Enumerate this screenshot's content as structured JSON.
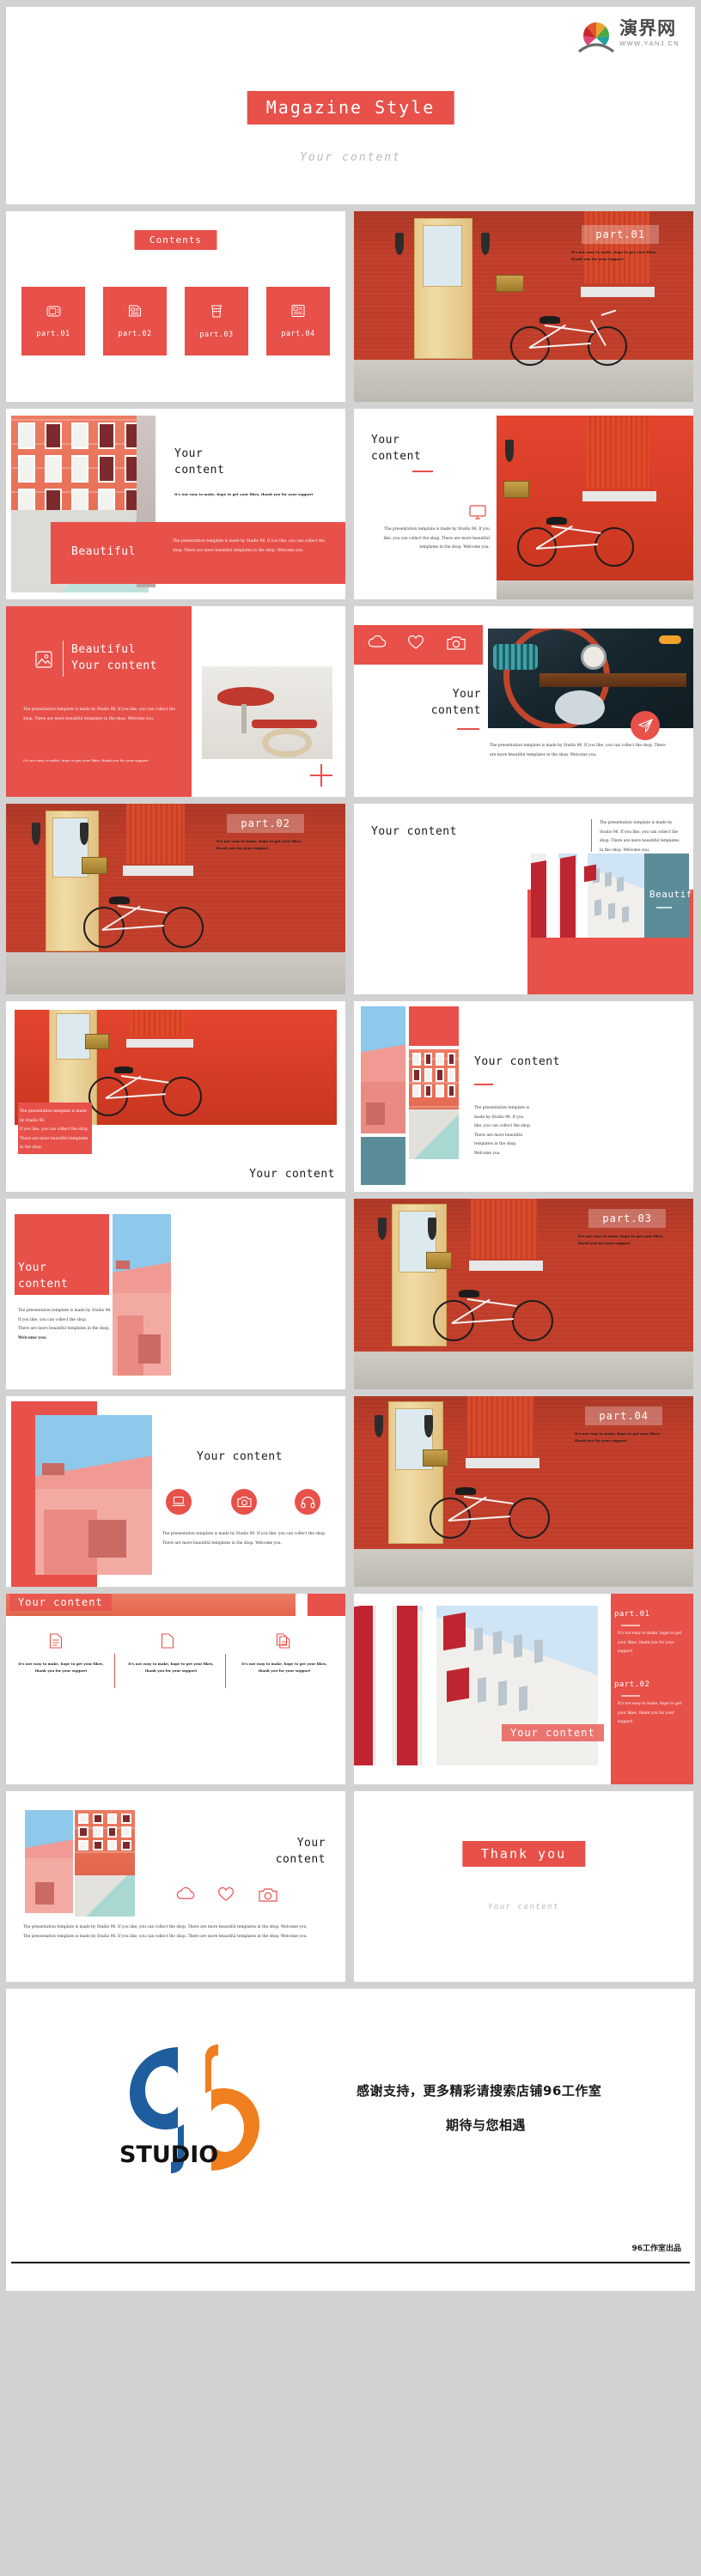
{
  "brand": {
    "name_cn": "演界网",
    "url": "WWW.YANJ.CN",
    "logo_icon": "fan-logo-icon"
  },
  "cover": {
    "title": "Magazine Style",
    "subtitle": "Your content"
  },
  "common": {
    "heading_your": "Your",
    "heading_content": "content",
    "heading_your_content": "Your content",
    "beautiful": "Beautiful",
    "body_long": "The presentation template is made by Studio 96. If you like, you can collect the shop. There are more beautiful templates in the shop. Welcome you.",
    "body_l1": "The presentation template is made by Studio 96.",
    "body_l2": "If you like, you can collect the shop.",
    "body_l3": "There are more beautiful templates in the shop.",
    "welcome": "Welcome you.",
    "support_note": "It's not easy to make, hope to get your likes, thank you for your support",
    "support_l1": "It's not easy to make, hope to get your likes,",
    "support_l2": "thank you for your support"
  },
  "contents": {
    "title": "Contents",
    "cards": [
      {
        "label": "part.01",
        "icon": "tv-icon"
      },
      {
        "label": "part.02",
        "icon": "document-icon"
      },
      {
        "label": "part.03",
        "icon": "coffee-cup-icon"
      },
      {
        "label": "part.04",
        "icon": "newspaper-icon"
      }
    ]
  },
  "parts": {
    "p1": "part.01",
    "p2": "part.02",
    "p3": "part.03",
    "p4": "part.04"
  },
  "icons": {
    "cloud": "cloud-icon",
    "heart": "heart-icon",
    "camera": "camera-icon",
    "monitor": "monitor-icon",
    "image": "image-icon",
    "laptop": "laptop-icon",
    "headphone": "headphone-icon",
    "send": "send-icon",
    "file": "file-icon"
  },
  "thanks": {
    "title": "Thank you",
    "subtitle": "Your content"
  },
  "footer": {
    "logo_text": "STUDIO",
    "logo_number": "96",
    "line1": "感谢支持，更多精彩请搜索店铺96工作室",
    "line2": "期待与您相遇",
    "mark": "96工作室出品"
  },
  "colors": {
    "accent": "#e8504a",
    "page_bg": "#d2d2d2",
    "teal": "#5b8d99"
  }
}
